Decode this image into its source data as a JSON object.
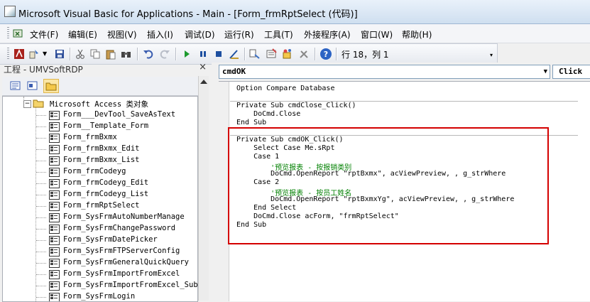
{
  "window": {
    "title": "Microsoft Visual Basic for Applications - Main - [Form_frmRptSelect (代码)]"
  },
  "menu": [
    "文件(F)",
    "编辑(E)",
    "视图(V)",
    "插入(I)",
    "调试(D)",
    "运行(R)",
    "工具(T)",
    "外接程序(A)",
    "窗口(W)",
    "帮助(H)"
  ],
  "toolbar": {
    "position": "行 18，列 1"
  },
  "project": {
    "title": "工程 - UMVSoftRDP",
    "close": "×",
    "folder_label": "Microsoft Access 类对象",
    "items": [
      "Form___DevTool_SaveAsText",
      "Form__Template_Form",
      "Form_frmBxmx",
      "Form_frmBxmx_Edit",
      "Form_frmBxmx_List",
      "Form_frmCodeyg",
      "Form_frmCodeyg_Edit",
      "Form_frmCodeyg_List",
      "Form_frmRptSelect",
      "Form_SysFrmAutoNumberManage",
      "Form_SysFrmChangePassword",
      "Form_SysFrmDatePicker",
      "Form_SysFrmFTPServerConfig",
      "Form_SysFrmGeneralQuickQuery",
      "Form_SysFrmImportFromExcel",
      "Form_SysFrmImportFromExcel_Sub",
      "Form_SysFrmLogin"
    ]
  },
  "code": {
    "object": "cmdOK",
    "procedure": "Click",
    "lines": [
      {
        "text": "Option Compare Database"
      },
      {
        "text": ""
      },
      {
        "text": "Private Sub cmdClose_Click()"
      },
      {
        "text": "    DoCmd.Close"
      },
      {
        "text": "End Sub"
      },
      {
        "text": ""
      },
      {
        "text": "Private Sub cmdOK_Click()"
      },
      {
        "text": "    Select Case Me.sRpt"
      },
      {
        "text": "    Case 1"
      },
      {
        "text": "        '预览报表 - 按报销类别",
        "comment": true
      },
      {
        "text": "        DoCmd.OpenReport \"rptBxmx\", acViewPreview, , g_strWhere"
      },
      {
        "text": "    Case 2"
      },
      {
        "text": "        '预览报表 - 按员工姓名",
        "comment": true
      },
      {
        "text": "        DoCmd.OpenReport \"rptBxmxYg\", acViewPreview, , g_strWhere"
      },
      {
        "text": "    End Select"
      },
      {
        "text": "    DoCmd.Close acForm, \"frmRptSelect\""
      },
      {
        "text": "End Sub"
      }
    ]
  },
  "colors": {
    "highlight": "#d40000",
    "comment": "#008000"
  }
}
